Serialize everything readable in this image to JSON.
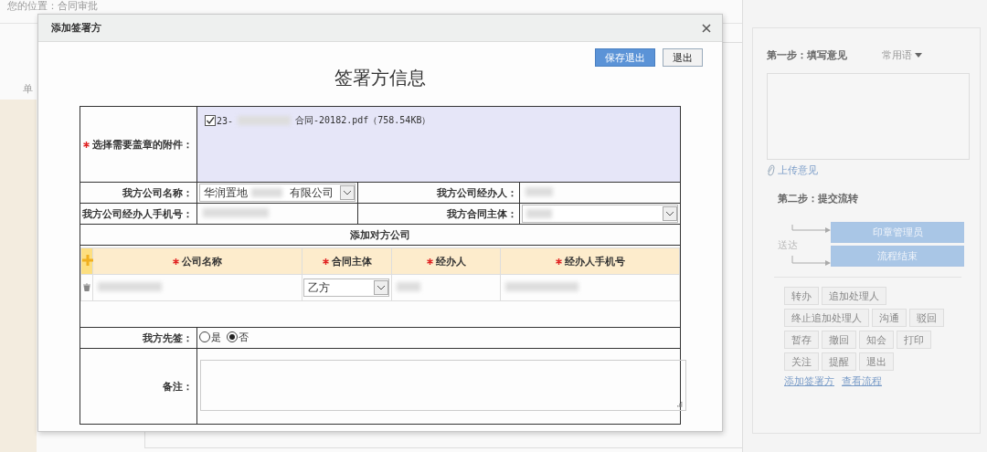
{
  "background_page": {
    "breadcrumb": "您的位置：合同审批",
    "column_label": "单"
  },
  "side_panel": {
    "step1_label": "第一步：填写意见",
    "phrases_dropdown": "常用语",
    "upload_link": "上传意见",
    "step2_label": "第二步：提交流转",
    "route_label": "送达",
    "recipients": [
      "印章管理员",
      "流程结束"
    ],
    "action_rows": [
      [
        "转办",
        "追加处理人"
      ],
      [
        "终止追加处理人",
        "沟通",
        "驳回"
      ],
      [
        "暂存",
        "撤回",
        "知会",
        "打印"
      ],
      [
        "关注",
        "提醒",
        "退出"
      ]
    ],
    "links": [
      "添加签署方",
      "查看流程"
    ]
  },
  "dialog": {
    "title": "添加签署方",
    "buttons": [
      {
        "label": "保存退出",
        "kind": "primary"
      },
      {
        "label": "退出",
        "kind": "default"
      }
    ],
    "heading": "签署方信息",
    "attachment": {
      "label": "选择需要盖章的附件：",
      "required": true,
      "files": [
        {
          "name_start": "23-",
          "name_end": "合同-20182.pdf（758.54KB）",
          "checked": true
        }
      ]
    },
    "company_name": {
      "label": "我方公司名称：",
      "value_start": "华润置地",
      "value_end": "有限公司"
    },
    "handler": {
      "label": "我方公司经办人："
    },
    "handler_phone": {
      "label": "我方公司经办人手机号："
    },
    "contract_party": {
      "label": "我方合同主体："
    },
    "counterparty_section": "添加对方公司",
    "counterparty_columns": [
      {
        "label": "公司名称",
        "required": true
      },
      {
        "label": "合同主体",
        "required": true
      },
      {
        "label": "经办人",
        "required": true
      },
      {
        "label": "经办人手机号",
        "required": true
      }
    ],
    "counterparty_rows": [
      {
        "contract_party": "乙方"
      }
    ],
    "sign_first": {
      "label": "我方先签：",
      "options": [
        {
          "label": "是",
          "selected": false
        },
        {
          "label": "否",
          "selected": true
        }
      ]
    },
    "remarks": {
      "label": "备注："
    }
  }
}
